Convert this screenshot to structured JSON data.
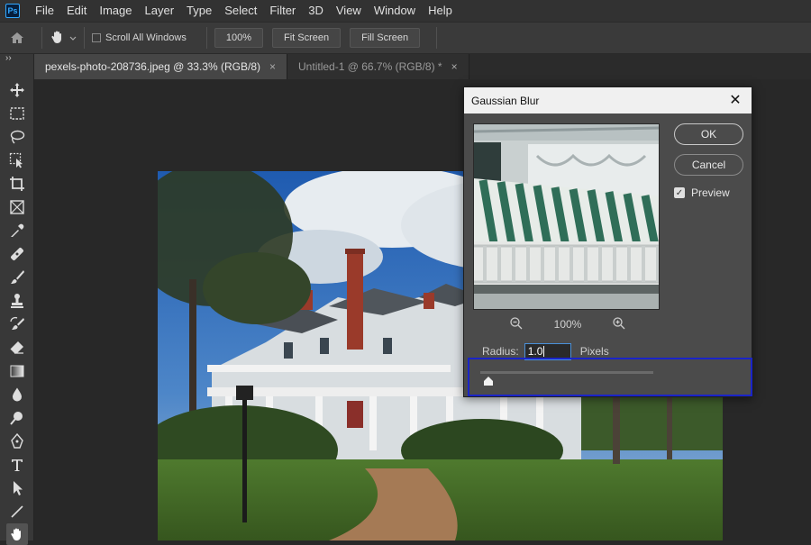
{
  "app": {
    "logo": "Ps"
  },
  "menu": [
    "File",
    "Edit",
    "Image",
    "Layer",
    "Type",
    "Select",
    "Filter",
    "3D",
    "View",
    "Window",
    "Help"
  ],
  "options_bar": {
    "scroll_all_windows": "Scroll All Windows",
    "zoom_value": "100%",
    "fit_screen": "Fit Screen",
    "fill_screen": "Fill Screen"
  },
  "tabs": [
    {
      "label": "pexels-photo-208736.jpeg @ 33.3% (RGB/8)",
      "close": "×",
      "active": true
    },
    {
      "label": "Untitled-1 @ 66.7% (RGB/8) *",
      "close": "×",
      "active": false
    }
  ],
  "toolbar_toggle": "››",
  "tools": [
    "move-tool",
    "marquee-tool",
    "lasso-tool",
    "object-select-tool",
    "crop-tool",
    "frame-tool",
    "eyedropper-tool",
    "healing-brush-tool",
    "brush-tool",
    "clone-stamp-tool",
    "history-brush-tool",
    "eraser-tool",
    "gradient-tool",
    "blur-tool",
    "dodge-tool",
    "pen-tool",
    "type-tool",
    "path-select-tool",
    "line-tool",
    "hand-tool"
  ],
  "dialog": {
    "title": "Gaussian Blur",
    "close": "✕",
    "ok": "OK",
    "cancel": "Cancel",
    "preview_label": "Preview",
    "preview_checked": true,
    "zoom_percent": "100%",
    "radius_label": "Radius:",
    "radius_value": "1.0",
    "radius_unit": "Pixels"
  },
  "colors": {
    "accent_blue": "#31a8ff",
    "highlight": "#1a24c8"
  }
}
